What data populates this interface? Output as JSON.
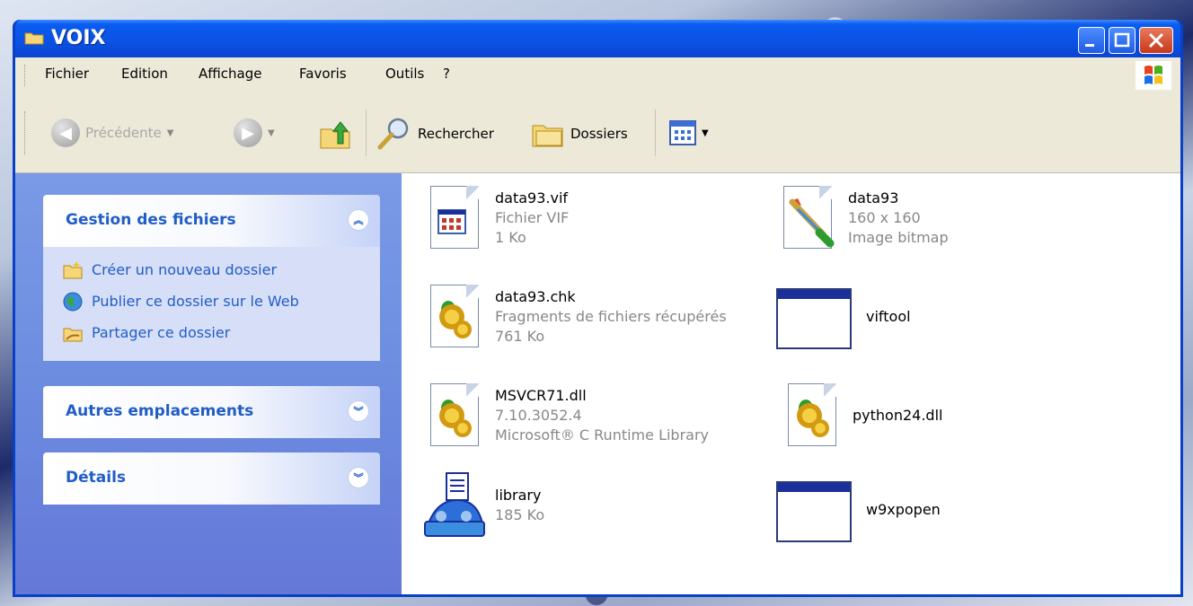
{
  "window": {
    "title": "VOIX"
  },
  "menu": [
    "Fichier",
    "Edition",
    "Affichage",
    "Favoris",
    "Outils",
    "?"
  ],
  "toolbar": {
    "back_label": "Précédente",
    "search_label": "Rechercher",
    "folders_label": "Dossiers"
  },
  "tasks_panel": {
    "title": "Gestion des fichiers",
    "items": [
      {
        "label": "Créer un nouveau dossier",
        "icon": "new-folder-icon"
      },
      {
        "label": "Publier ce dossier sur le Web",
        "icon": "globe-icon"
      },
      {
        "label": "Partager ce dossier",
        "icon": "share-folder-icon"
      }
    ]
  },
  "other_places_panel": {
    "title": "Autres emplacements"
  },
  "details_panel": {
    "title": "Détails"
  },
  "files": [
    {
      "name": "data93.vif",
      "line2": "Fichier VIF",
      "line3": "1 Ko",
      "icon": "vif-file-icon"
    },
    {
      "name": "data93",
      "line2": "160 x 160",
      "line3": "Image bitmap",
      "icon": "bitmap-icon"
    },
    {
      "name": "data93.chk",
      "line2": "Fragments de fichiers récupérés",
      "line3": "761 Ko",
      "icon": "dll-file-icon"
    },
    {
      "name": "viftool",
      "line2": "",
      "line3": "",
      "icon": "application-icon"
    },
    {
      "name": "MSVCR71.dll",
      "line2": "7.10.3052.4",
      "line3": "Microsoft® C Runtime Library",
      "icon": "dll-file-icon"
    },
    {
      "name": "python24.dll",
      "line2": "",
      "line3": "",
      "icon": "dll-file-icon"
    },
    {
      "name": "library",
      "line2": "185 Ko",
      "line3": "",
      "icon": "library-icon"
    },
    {
      "name": "w9xpopen",
      "line2": "",
      "line3": "",
      "icon": "application-icon"
    }
  ],
  "colors": {
    "titlebar": "#0b51e4",
    "panel_link": "#215dc6",
    "left_pane": "#7a9ae6",
    "chrome": "#ece9d8"
  }
}
